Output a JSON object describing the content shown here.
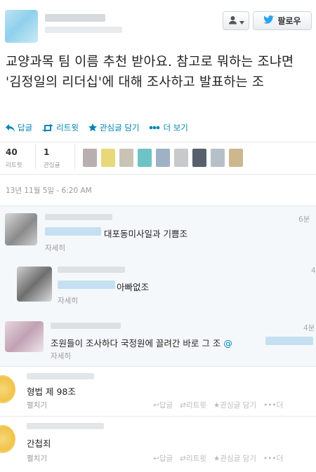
{
  "header": {
    "follow_label": "팔로우",
    "icons": {
      "user_menu": "person-icon",
      "follow": "twitter-bird-icon"
    }
  },
  "tweet": {
    "text": "교양과목 팀 이름 추천 받아요. 참고로 뭐하는 조냐면 '김정일의 리더십'에 대해 조사하고 발표하는 조",
    "actions": {
      "reply": "답글",
      "retweet": "리트윗",
      "favorite": "관심글 담기",
      "more": "더 보기"
    },
    "stats": {
      "retweets_count": "40",
      "retweets_label": "리트윗",
      "favorites_count": "1",
      "favorites_label": "관심글"
    },
    "timestamp": "13년 11월 5일 - 6:20 AM"
  },
  "replies": [
    {
      "text": "대포동미사일과 기쁨조",
      "link": "자세히",
      "time": "6분"
    },
    {
      "text": "아빠없조",
      "link": "자세히",
      "time": "4"
    },
    {
      "text": "조원들이 조사하다 국정원에 끌려간 바로 그 조 ",
      "mention": "@",
      "link": "자세히",
      "time": "4분"
    },
    {
      "text": "형법 제 98조",
      "link": "펼치기",
      "actions": {
        "reply": "답글",
        "retweet": "리트윗",
        "favorite": "관심글 담기",
        "more": "더"
      }
    },
    {
      "text": "간첩죄",
      "link": "펼치기",
      "actions": {
        "reply": "답글",
        "retweet": "리트윗",
        "favorite": "관심글 담기",
        "more": "더"
      }
    }
  ],
  "colors": {
    "link_blue": "#0084b4",
    "reply_bg": "#f5f8fa"
  }
}
